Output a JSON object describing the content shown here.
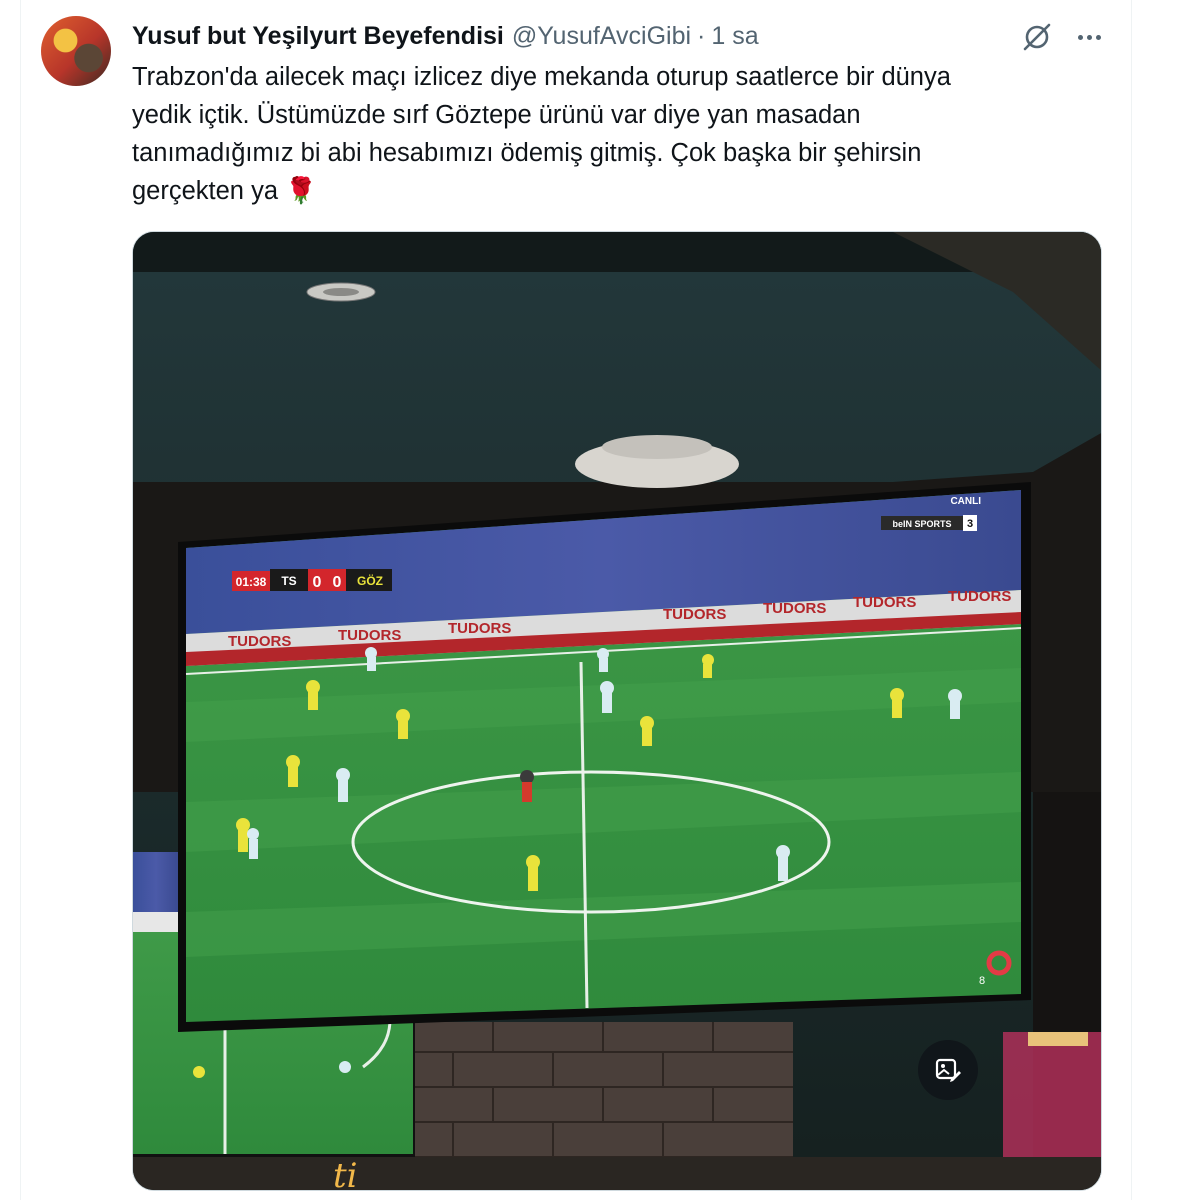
{
  "tweet": {
    "display_name": "Yusuf but Yeşilyurt Beyefendisi",
    "handle": "@YusufAvciGibi",
    "separator": "·",
    "time": "1 sa",
    "text": "Trabzon'da ailecek maçı izlicez diye mekanda oturup saatlerce bir dünya\nyedik içtik. Üstümüzde sırf Göztepe ürünü var diye yan masadan\ntanımadığımız bi abi hesabımızı ödemiş gitmiş. Çok başka bir şehirsin\ngerçekten ya 🌹"
  },
  "icons": {
    "avatar": "user-avatar",
    "grok": "grok-icon",
    "more": "more-horizontal-icon",
    "image_action": "image-edit-icon"
  },
  "tv_overlay": {
    "clock": "01:38",
    "home_team": "TS",
    "home_score": "0",
    "away_score": "0",
    "away_team": "GÖZ",
    "live_label": "CANLI",
    "channel": "beIN SPORTS",
    "channel_number": "3",
    "ad_text": "TUDORS",
    "corner_number": "8"
  },
  "colors": {
    "text_primary": "#0f1419",
    "text_secondary": "#536471",
    "pitch": "#3f9a48",
    "home_kit": "#d9ecf2",
    "away_kit": "#e9e33b"
  }
}
